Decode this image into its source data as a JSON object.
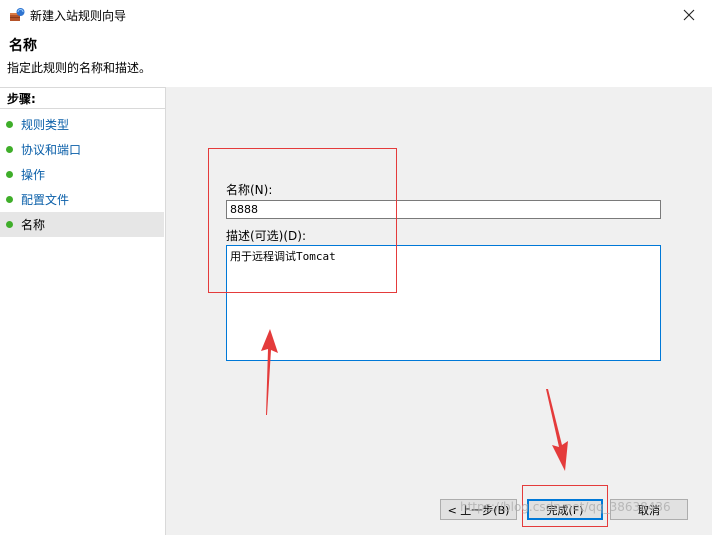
{
  "window": {
    "title": "新建入站规则向导",
    "app_icon": "firewall-shield-icon",
    "close_icon": "close-icon"
  },
  "header": {
    "title": "名称",
    "description": "指定此规则的名称和描述。"
  },
  "sidebar": {
    "title": "步骤:",
    "items": [
      {
        "label": "规则类型"
      },
      {
        "label": "协议和端口"
      },
      {
        "label": "操作"
      },
      {
        "label": "配置文件"
      },
      {
        "label": "名称"
      }
    ],
    "current_index": 4
  },
  "form": {
    "name_label": "名称(N):",
    "name_value": "8888",
    "desc_label": "描述(可选)(D):",
    "desc_value": "用于远程调试Tomcat"
  },
  "buttons": {
    "back": "< 上一步(B)",
    "finish": "完成(F)",
    "cancel": "取消"
  },
  "watermark": "https://blog.csdn.net/qq_38638436",
  "colors": {
    "link": "#0a5fa9",
    "step_dot": "#3fae2a",
    "annotation_red": "#e43b3b",
    "focus_blue": "#0078d7"
  }
}
